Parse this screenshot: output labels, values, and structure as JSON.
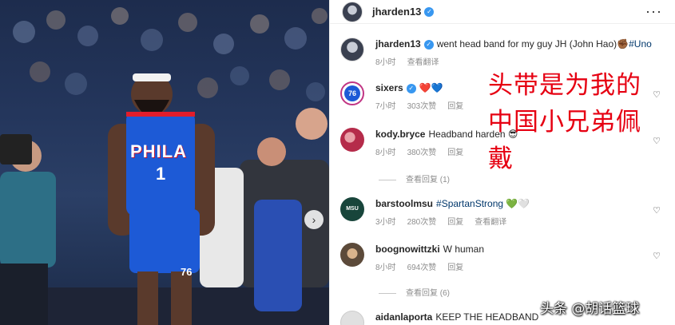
{
  "post": {
    "author": "jharden13",
    "more_icon": "more-horizontal-icon",
    "caption": {
      "user": "jharden13",
      "text": "went head band for my guy JH (John Hao)",
      "emoji": "✊🏾",
      "hashtag": "#Uno",
      "time": "8小时",
      "translate": "查看翻译"
    }
  },
  "comments": [
    {
      "user": "sixers",
      "text": "",
      "emoji": "❤️💙",
      "time": "7小时",
      "likes": "303次赞",
      "reply": "回复"
    },
    {
      "user": "kody.bryce",
      "text": "Headband harden",
      "emoji": "😎",
      "time": "8小时",
      "likes": "380次赞",
      "reply": "回复",
      "view_replies": "查看回复 (1)"
    },
    {
      "user": "barstoolmsu",
      "text": "#SpartanStrong",
      "emoji": "💚🤍",
      "time": "3小时",
      "likes": "280次赞",
      "reply": "回复",
      "translate": "查看翻译"
    },
    {
      "user": "boognowittzki",
      "text": "W human",
      "time": "8小时",
      "likes": "694次赞",
      "reply": "回复",
      "view_replies": "查看回复 (6)"
    },
    {
      "user": "aidanlaporta",
      "text": "KEEP THE HEADBAND"
    }
  ],
  "photo": {
    "jersey_text": "PHILA",
    "jersey_number": "1",
    "shorts_logo": "76"
  },
  "overlay_text": "头带是为我的中国小兄弟佩戴",
  "watermark": "头条 @胡话篮球",
  "colors": {
    "verified": "#3897f0",
    "sixers_blue": "#1d5ad6",
    "overlay_red": "#e60012"
  }
}
